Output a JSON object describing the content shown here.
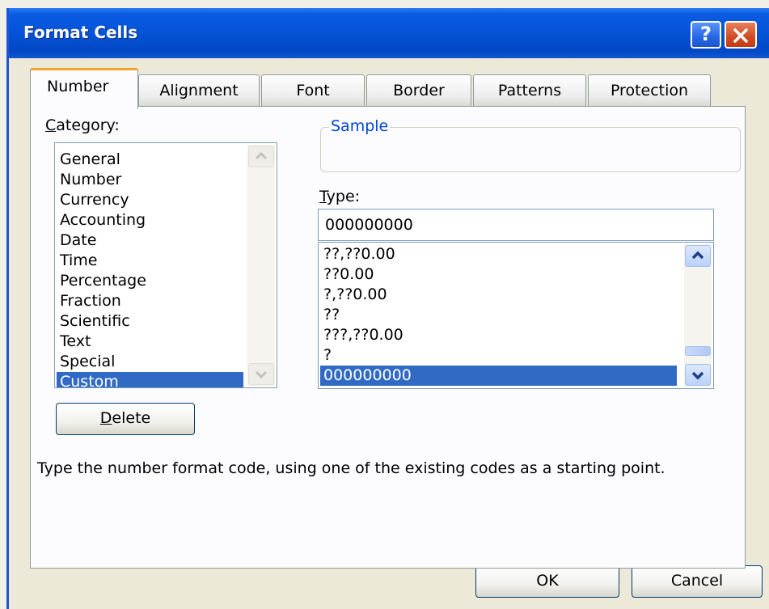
{
  "dialog": {
    "title": "Format Cells",
    "help_label": "?"
  },
  "tabs": [
    {
      "label": "Number",
      "active": true
    },
    {
      "label": "Alignment",
      "active": false
    },
    {
      "label": "Font",
      "active": false
    },
    {
      "label": "Border",
      "active": false
    },
    {
      "label": "Patterns",
      "active": false
    },
    {
      "label": "Protection",
      "active": false
    }
  ],
  "category": {
    "label_mnemonic": "C",
    "label_rest": "ategory:",
    "items": [
      "General",
      "Number",
      "Currency",
      "Accounting",
      "Date",
      "Time",
      "Percentage",
      "Fraction",
      "Scientific",
      "Text",
      "Special",
      "Custom"
    ],
    "selected": "Custom"
  },
  "sample": {
    "legend": "Sample",
    "value": ""
  },
  "type": {
    "label_mnemonic": "T",
    "label_rest": "ype:",
    "value": "000000000",
    "formats": [
      "??,??0.00",
      "??0.00",
      "?,??0.00",
      "??",
      "???,??0.00",
      "?",
      "000000000"
    ],
    "selected": "000000000"
  },
  "delete_button": {
    "label_mnemonic": "D",
    "label_rest": "elete"
  },
  "hint": "Type the number format code, using one of the existing codes as a starting point.",
  "footer": {
    "ok_label": "OK",
    "cancel_label": "Cancel"
  },
  "colors": {
    "title_bar": "#0553d6",
    "selection": "#316ac5",
    "active_tab_accent": "#f0a22a",
    "sample_legend": "#0046d5",
    "close_button": "#d14b22"
  }
}
